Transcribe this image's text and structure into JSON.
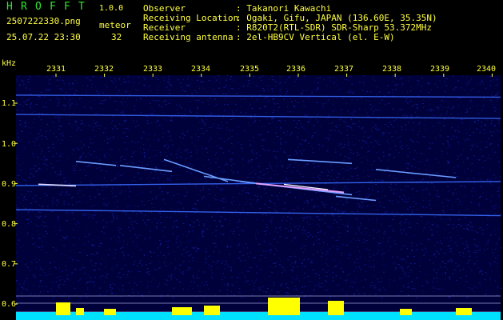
{
  "app": {
    "title_letters": [
      "H",
      "R",
      "O",
      "F",
      "F",
      "T"
    ],
    "version": "1.0.0",
    "filename": "2507222330.png",
    "datetime": "25.07.22 23:30",
    "mode_label": "meteor",
    "meteor_count": "32"
  },
  "info": {
    "rows": [
      {
        "label": "Observer",
        "value": ": Takanori Kawachi"
      },
      {
        "label": "Receiving Location",
        "value": ": Ogaki, Gifu, JAPAN (136.60E, 35.35N)"
      },
      {
        "label": "Receiver",
        "value": ": R820T2(RTL-SDR) SDR-Sharp 53.372MHz"
      },
      {
        "label": "Receiving antenna",
        "value": ": 2el-HB9CV Vertical (el. E-W)"
      }
    ]
  },
  "spectrogram": {
    "y_unit": "kHz",
    "x_ticks": [
      "2331",
      "2332",
      "2333",
      "2334",
      "2335",
      "2336",
      "2337",
      "2338",
      "2339",
      "2340"
    ],
    "y_ticks": [
      "1.1",
      "1.0",
      "0.9",
      "0.8",
      "0.7",
      "0.6"
    ],
    "y_tick_values": [
      1.1,
      1.0,
      0.9,
      0.8,
      0.7,
      0.6
    ],
    "ylim": [
      0.58,
      1.17
    ],
    "colors": {
      "background": "#00003a",
      "noise": "#1a2cc8",
      "trace": "#3a6cff",
      "hot": "#d8d8ff",
      "tick_text": "#ffff40",
      "bar_yellow": "#ffff00",
      "bar_cyan": "#00e0ff"
    }
  }
}
